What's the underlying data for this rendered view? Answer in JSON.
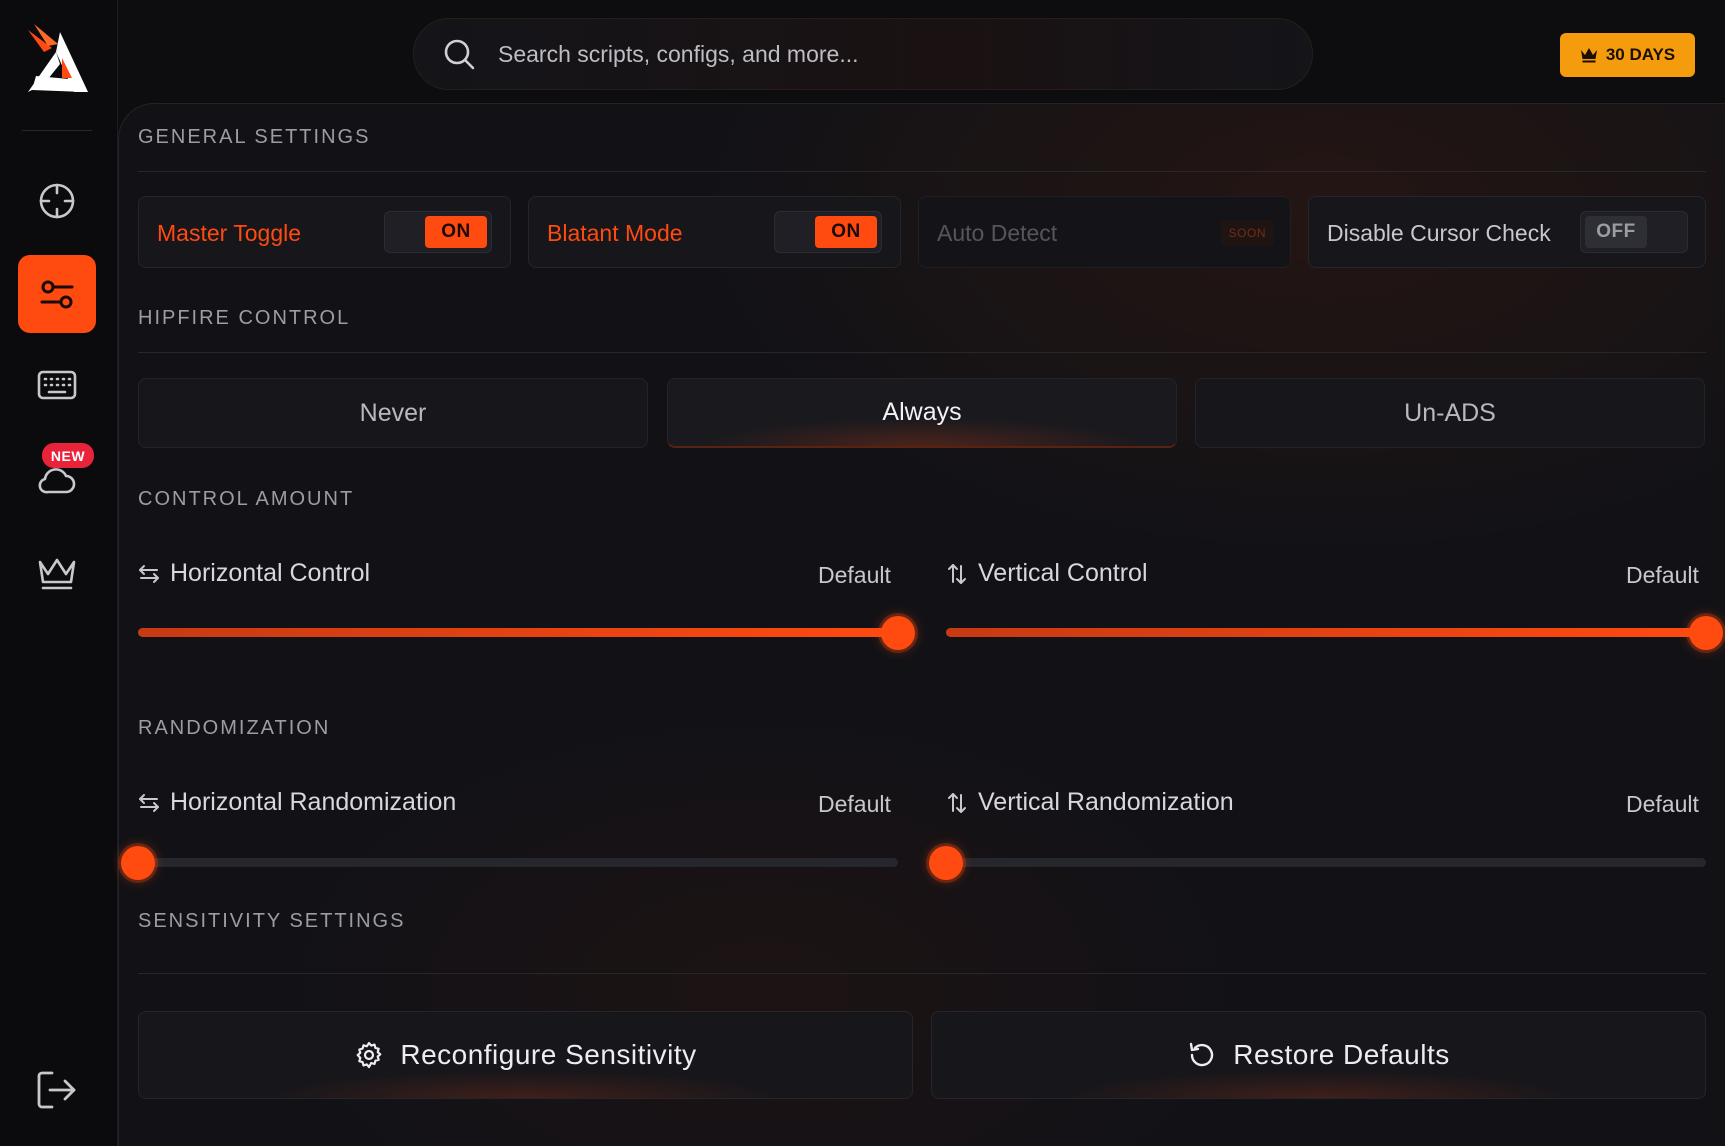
{
  "search": {
    "placeholder": "Search scripts, configs, and more..."
  },
  "subscription": {
    "label": "30 DAYS",
    "icon": "crown-icon",
    "color": "#f59b0e"
  },
  "sidebar": {
    "items": [
      {
        "id": "aim",
        "icon": "crosshair-icon",
        "active": false
      },
      {
        "id": "settings",
        "icon": "sliders-icon",
        "active": true
      },
      {
        "id": "keybinds",
        "icon": "keyboard-icon",
        "active": false
      },
      {
        "id": "cloud",
        "icon": "cloud-icon",
        "active": false,
        "badge": "NEW"
      },
      {
        "id": "premium",
        "icon": "crown-icon",
        "active": false
      }
    ],
    "logout_icon": "logout-icon",
    "accent": "#ff4a10"
  },
  "general": {
    "title": "GENERAL SETTINGS",
    "toggles": [
      {
        "label": "Master Toggle",
        "state": "ON"
      },
      {
        "label": "Blatant Mode",
        "state": "ON"
      },
      {
        "label": "Auto Detect",
        "state": "SOON"
      },
      {
        "label": "Disable Cursor Check",
        "state": "OFF"
      }
    ]
  },
  "hipfire": {
    "title": "HIPFIRE CONTROL",
    "options": [
      "Never",
      "Always",
      "Un-ADS"
    ],
    "selected": "Always"
  },
  "control": {
    "title": "CONTROL AMOUNT",
    "horizontal": {
      "label": "Horizontal Control",
      "value_label": "Default",
      "level": 1.0
    },
    "vertical": {
      "label": "Vertical Control",
      "value_label": "Default",
      "level": 1.0
    }
  },
  "randomization": {
    "title": "RANDOMIZATION",
    "horizontal": {
      "label": "Horizontal Randomization",
      "value_label": "Default",
      "level": 0.0
    },
    "vertical": {
      "label": "Vertical Randomization",
      "value_label": "Default",
      "level": 0.0
    }
  },
  "sensitivity": {
    "title": "SENSITIVITY SETTINGS",
    "reconfigure_label": "Reconfigure Sensitivity",
    "restore_label": "Restore Defaults"
  }
}
